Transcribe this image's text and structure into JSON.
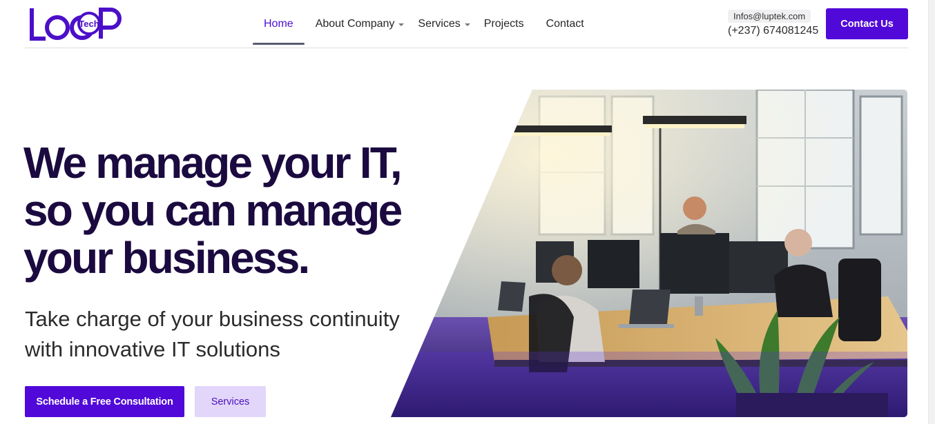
{
  "brand": {
    "logo_text": "LOOP",
    "logo_badge": "Tech",
    "accent_color": "#5109d9",
    "heading_color": "#1b0a3f"
  },
  "nav": {
    "items": [
      {
        "label": "Home",
        "active": true
      },
      {
        "label": "About Company",
        "dropdown": true
      },
      {
        "label": "Services",
        "dropdown": true
      },
      {
        "label": "Projects"
      },
      {
        "label": "Contact"
      }
    ]
  },
  "contact": {
    "email": "Infos@luptek.com",
    "phone": "(+237) 674081245",
    "button_label": "Contact Us"
  },
  "hero": {
    "title_line1": "We manage your IT,",
    "title_line2": "so you can manage",
    "title_line3": "your business.",
    "subtitle_line1": "Take charge of your business continuity",
    "subtitle_line2": "with innovative IT solutions",
    "primary_button": "Schedule a Free Consultation",
    "secondary_button": "Services",
    "image_alt": "office-team-photo"
  },
  "icons": {
    "nav_dropdown": "chevron-down-icon"
  }
}
